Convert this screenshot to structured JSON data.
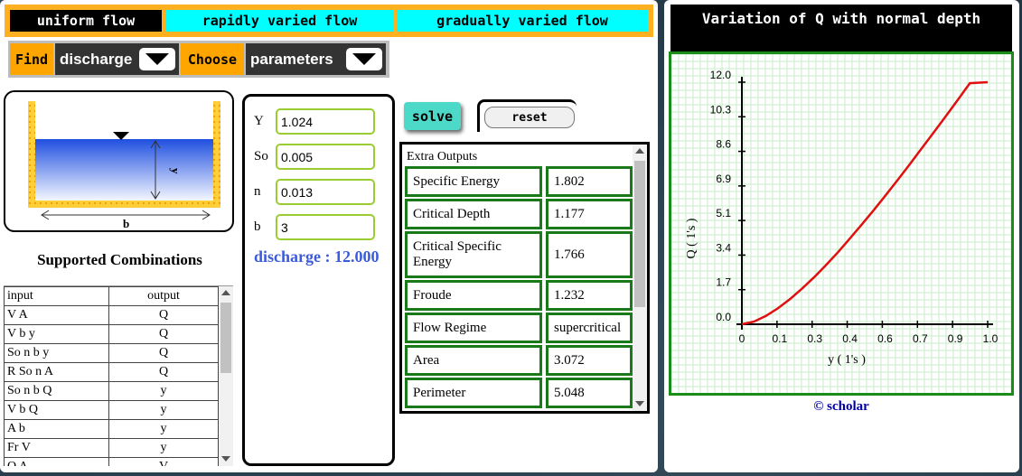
{
  "tabs": {
    "uniform": "uniform flow",
    "rapid": "rapidly varied flow",
    "gradual": "gradually varied flow"
  },
  "toolbar": {
    "find_label": "Find",
    "find_value": "discharge",
    "choose_label": "Choose",
    "choose_value": "parameters"
  },
  "diagram": {
    "depth_label": "y",
    "width_label": "b"
  },
  "combinations": {
    "title": "Supported Combinations",
    "headers": [
      "input",
      "output"
    ],
    "rows": [
      [
        "V A",
        "Q"
      ],
      [
        "V b y",
        "Q"
      ],
      [
        "So n b y",
        "Q"
      ],
      [
        "R So n A",
        "Q"
      ],
      [
        "So n b Q",
        "y"
      ],
      [
        "V b Q",
        "y"
      ],
      [
        "A b",
        "y"
      ],
      [
        "Fr V",
        "y"
      ],
      [
        "Q A",
        "V"
      ]
    ]
  },
  "inputs": {
    "y_label": "Y",
    "y_value": "1.024",
    "so_label": "So",
    "so_value": "0.005",
    "n_label": "n",
    "n_value": "0.013",
    "b_label": "b",
    "b_value": "3"
  },
  "result": "discharge : 12.000",
  "buttons": {
    "solve": "solve",
    "reset": "reset"
  },
  "extra": {
    "title": "Extra Outputs",
    "rows": [
      {
        "name": "Specific Energy",
        "value": "1.802"
      },
      {
        "name": "Critical Depth",
        "value": "1.177"
      },
      {
        "name": "Critical Specific Energy",
        "value": "1.766"
      },
      {
        "name": "Froude",
        "value": "1.232"
      },
      {
        "name": "Flow Regime",
        "value": "supercritical"
      },
      {
        "name": "Area",
        "value": "3.072"
      },
      {
        "name": "Perimeter",
        "value": "5.048"
      }
    ]
  },
  "chart_data": {
    "type": "line",
    "title": "Variation of Q with normal depth",
    "xlabel": "y ( 1's )",
    "ylabel": "Q ( 1's )",
    "xlim": [
      0,
      1.024
    ],
    "ylim": [
      0,
      12.0
    ],
    "x_ticks": [
      "0",
      "0.1",
      "0.3",
      "0.4",
      "0.6",
      "0.7",
      "0.9",
      "1.0"
    ],
    "y_ticks": [
      "0.0",
      "1.7",
      "3.4",
      "5.1",
      "6.9",
      "8.6",
      "10.3",
      "12.0"
    ],
    "grid": true,
    "line_color": "#e01010",
    "series": [
      {
        "x": [
          0.0,
          0.05,
          0.1,
          0.15,
          0.2,
          0.25,
          0.3,
          0.35,
          0.4,
          0.45,
          0.5,
          0.55,
          0.6,
          0.65,
          0.7,
          0.75,
          0.8,
          0.85,
          0.9,
          0.95,
          1.0,
          1.024
        ],
        "y": [
          0.0,
          0.13,
          0.41,
          0.79,
          1.24,
          1.76,
          2.32,
          2.93,
          3.57,
          4.25,
          4.95,
          5.67,
          6.41,
          7.17,
          7.94,
          8.73,
          9.52,
          10.32,
          11.13,
          11.95,
          11.6,
          12.0
        ]
      }
    ]
  },
  "copyright": "© scholar"
}
